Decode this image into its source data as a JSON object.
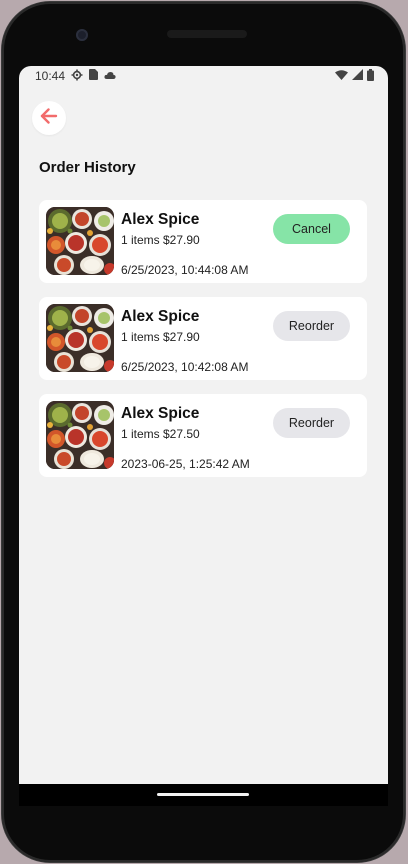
{
  "status_bar": {
    "time": "10:44"
  },
  "header": {
    "title": "Order History"
  },
  "colors": {
    "accent_back": "#f26b6b",
    "cancel_bg": "#86e4a7",
    "reorder_bg": "#e6e6ea",
    "screen_bg": "#f2f2f2"
  },
  "orders": [
    {
      "restaurant": "Alex Spice",
      "summary": "1 items $27.90",
      "timestamp": "6/25/2023, 10:44:08 AM",
      "action": "Cancel"
    },
    {
      "restaurant": "Alex Spice",
      "summary": "1 items $27.90",
      "timestamp": "6/25/2023, 10:42:08 AM",
      "action": "Reorder"
    },
    {
      "restaurant": "Alex Spice",
      "summary": "1 items $27.50",
      "timestamp": "2023-06-25, 1:25:42 AM",
      "action": "Reorder"
    }
  ]
}
